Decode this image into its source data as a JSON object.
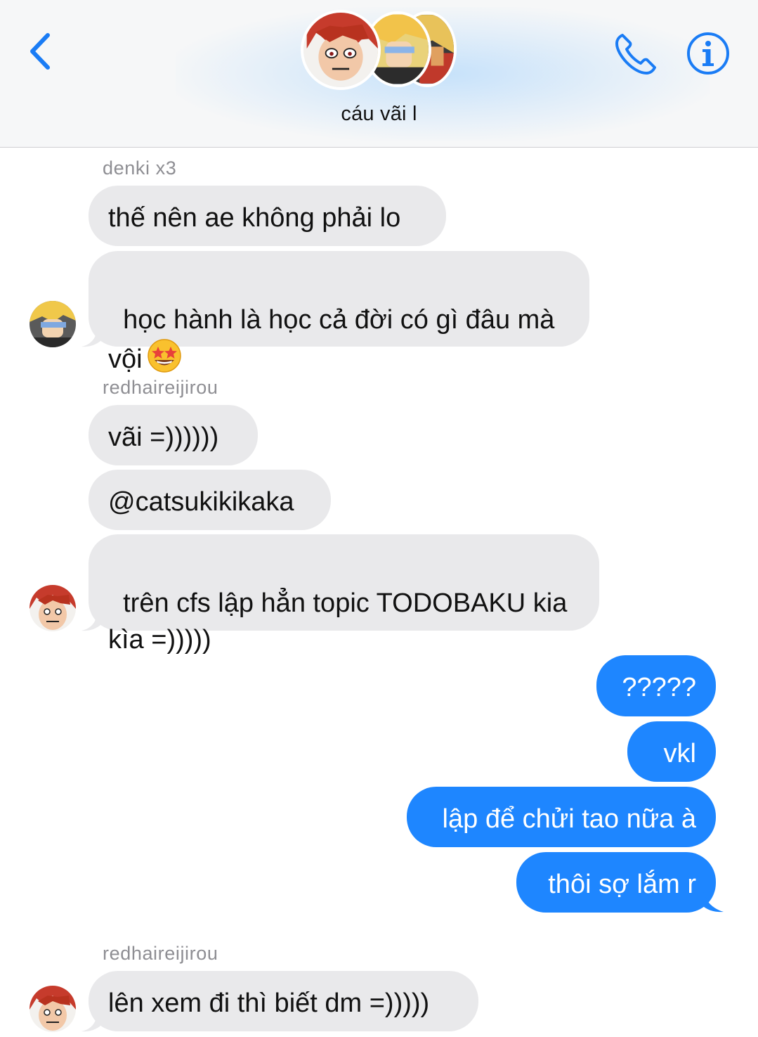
{
  "header": {
    "title": "cáu vãi l",
    "back_icon": "chevron-left-icon",
    "call_icon": "phone-icon",
    "info_icon": "info-icon",
    "accent_color": "#1a7cf5"
  },
  "messages": {
    "group1": {
      "sender": "denki x3",
      "bubble1": "thế nên ae không phải lo",
      "bubble2_line1": "học hành là học cả đời có gì đâu mà",
      "bubble2_line2": "vội",
      "emoji": "star-struck-emoji"
    },
    "group2": {
      "sender": "redhaireijirou",
      "bubble1": "vãi =))))))",
      "bubble2": "@catsukikikaka",
      "bubble3_line1": "trên cfs lập hẳn topic TODOBAKU kia",
      "bubble3_line2": "kìa =)))))"
    },
    "outgoing": {
      "bubble1": "?????",
      "bubble2": "vkl",
      "bubble3": "lập để chửi tao nữa à",
      "bubble4": "thôi sợ lắm r"
    },
    "group3": {
      "sender": "redhaireijirou",
      "bubble1": "lên xem đi thì biết dm =)))))"
    }
  },
  "colors": {
    "incoming_bubble": "#e9e9eb",
    "outgoing_bubble": "#1e86ff",
    "sender_name": "#8e8e93"
  }
}
